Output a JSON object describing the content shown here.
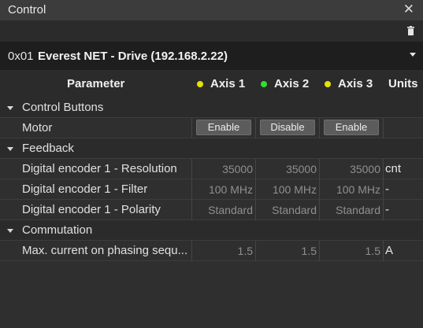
{
  "window": {
    "title": "Control"
  },
  "drive": {
    "id": "0x01",
    "name": "Everest NET - Drive (192.168.2.22)"
  },
  "table": {
    "headers": {
      "parameter": "Parameter",
      "axis1": "Axis 1",
      "axis2": "Axis 2",
      "axis3": "Axis 3",
      "units": "Units"
    },
    "axis_status_colors": {
      "axis1": "#e8e000",
      "axis2": "#2ee02e",
      "axis3": "#e8e000"
    }
  },
  "sections": {
    "control_buttons": {
      "title": "Control Buttons",
      "motor": {
        "label": "Motor",
        "axis1": "Enable",
        "axis2": "Disable",
        "axis3": "Enable"
      }
    },
    "feedback": {
      "title": "Feedback",
      "resolution": {
        "label": "Digital encoder 1 - Resolution",
        "axis1": "35000",
        "axis2": "35000",
        "axis3": "35000",
        "unit": "cnt"
      },
      "filter": {
        "label": "Digital encoder 1 - Filter",
        "axis1": "100 MHz",
        "axis2": "100 MHz",
        "axis3": "100 MHz",
        "unit": "-"
      },
      "polarity": {
        "label": "Digital encoder 1 - Polarity",
        "axis1": "Standard",
        "axis2": "Standard",
        "axis3": "Standard",
        "unit": "-"
      }
    },
    "commutation": {
      "title": "Commutation",
      "max_current": {
        "label": "Max. current on phasing sequ...",
        "axis1": "1.5",
        "axis2": "1.5",
        "axis3": "1.5",
        "unit": "A"
      }
    }
  },
  "icons": {
    "close": "close-icon",
    "trash": "trash-icon",
    "dropdown": "chevron-down-icon"
  }
}
